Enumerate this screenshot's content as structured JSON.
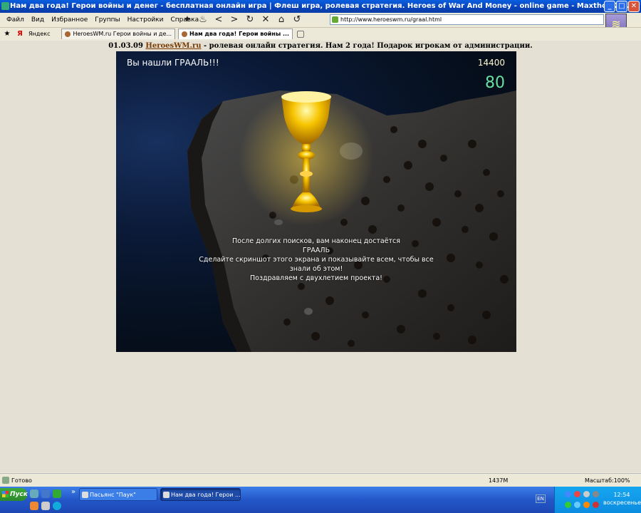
{
  "window": {
    "title": "Нам два года! Герои войны и денег - бесплатная онлайн игра | Флеш игра, ролевая стратегия. Heroes of War And Money - online game - Maxthon 2.1.4",
    "min": "_",
    "max": "□",
    "close": "✕"
  },
  "menu": {
    "items": [
      "Файл",
      "Вид",
      "Избранное",
      "Группы",
      "Настройки",
      "Справка"
    ]
  },
  "address": {
    "url": "http://www.heroeswm.ru/graal.html"
  },
  "tabs": {
    "yandex_label": "Яндекс",
    "items": [
      {
        "label": "HeroesWM.ru Герои войны и де..."
      },
      {
        "label": "Нам два года! Герои войны ..."
      }
    ]
  },
  "news": {
    "date": "01.03.09",
    "site": "HeroesWM.ru",
    "text": " - ролевая онлайн стратегия. Нам 2 года! Подарок игрокам от администрации."
  },
  "game": {
    "found": "Вы нашли ГРААЛЬ!!!",
    "score": "14400",
    "counter": "80",
    "message": [
      "После долгих поисков, вам наконец достаётся",
      "ГРААЛЬ",
      "Сделайте скриншот этого экрана и показывайте всем, чтобы все",
      "знали об этом!",
      "Поздравляем с двухлетием проекта!"
    ]
  },
  "status": {
    "text": "Готово",
    "memory": "1437M",
    "zoom": "Масштаб:100%"
  },
  "taskbar": {
    "start": "Пуск",
    "chevron": "»",
    "buttons": [
      {
        "label": "Пасьянс \"Паук\""
      },
      {
        "label": "Нам два года! Герои ..."
      }
    ],
    "lang": "EN",
    "time": "12:54",
    "day": "воскресенье"
  }
}
